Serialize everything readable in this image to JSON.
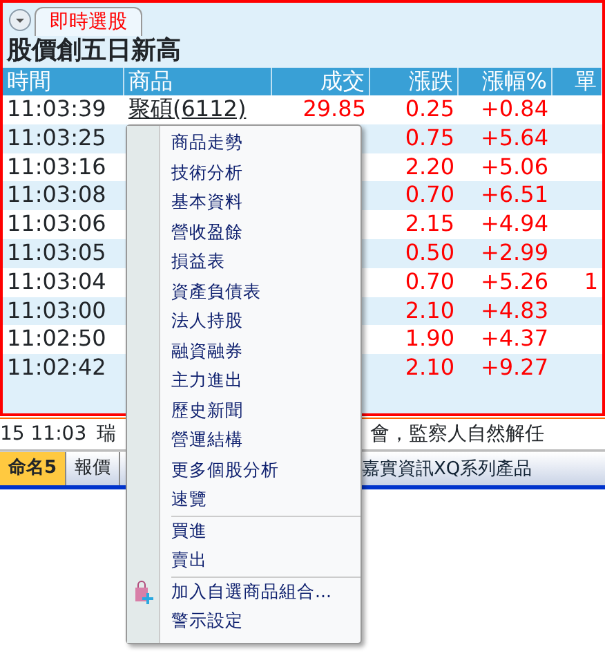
{
  "panel": {
    "tab": {
      "label": "即時選股",
      "selected": true
    },
    "title": "股價創五日新高",
    "table": {
      "columns": [
        "時間",
        "商品",
        "成交",
        "漲跌",
        "漲幅%",
        "單"
      ],
      "rows": [
        {
          "time": "11:03:39",
          "product": "聚碩(6112)",
          "price": "29.85",
          "change": "0.25",
          "pct": "+0.84"
        },
        {
          "time": "11:03:25",
          "change": "0.75",
          "pct": "+5.64"
        },
        {
          "time": "11:03:16",
          "change": "2.20",
          "pct": "+5.06"
        },
        {
          "time": "11:03:08",
          "change": "0.70",
          "pct": "+6.51"
        },
        {
          "time": "11:03:06",
          "change": "2.15",
          "pct": "+4.94"
        },
        {
          "time": "11:03:05",
          "change": "0.50",
          "pct": "+2.99"
        },
        {
          "time": "11:03:04",
          "change": "0.70",
          "pct": "+5.26",
          "volume": "1"
        },
        {
          "time": "11:03:00",
          "change": "2.10",
          "pct": "+4.83"
        },
        {
          "time": "11:02:50",
          "change": "1.90",
          "pct": "+4.37"
        },
        {
          "time": "11:02:42",
          "change": "2.10",
          "pct": "+9.27"
        }
      ]
    }
  },
  "news": {
    "time": "15 11:03",
    "text_1": "瑞",
    "text_2": "會，監察人自然解任"
  },
  "bottom_tabs": [
    {
      "label": "命名5",
      "selected": true
    },
    {
      "label": "報價",
      "selected": false
    }
  ],
  "marquee": "嘉實資訊XQ系列產品",
  "context_menu": {
    "items": [
      {
        "kind": "item",
        "label": "商品走勢"
      },
      {
        "kind": "item",
        "label": "技術分析"
      },
      {
        "kind": "item",
        "label": "基本資料"
      },
      {
        "kind": "item",
        "label": "營收盈餘"
      },
      {
        "kind": "item",
        "label": "損益表"
      },
      {
        "kind": "item",
        "label": "資產負債表"
      },
      {
        "kind": "item",
        "label": "法人持股"
      },
      {
        "kind": "item",
        "label": "融資融券"
      },
      {
        "kind": "item",
        "label": "主力進出"
      },
      {
        "kind": "item",
        "label": "歷史新聞"
      },
      {
        "kind": "item",
        "label": "營運結構"
      },
      {
        "kind": "item",
        "label": "更多個股分析"
      },
      {
        "kind": "item",
        "label": "速覽"
      },
      {
        "kind": "separator"
      },
      {
        "kind": "item",
        "label": "買進"
      },
      {
        "kind": "item",
        "label": "賣出"
      },
      {
        "kind": "separator"
      },
      {
        "kind": "icon-item",
        "label": "加入自選商品組合..."
      },
      {
        "kind": "item",
        "label": "警示設定"
      }
    ]
  }
}
